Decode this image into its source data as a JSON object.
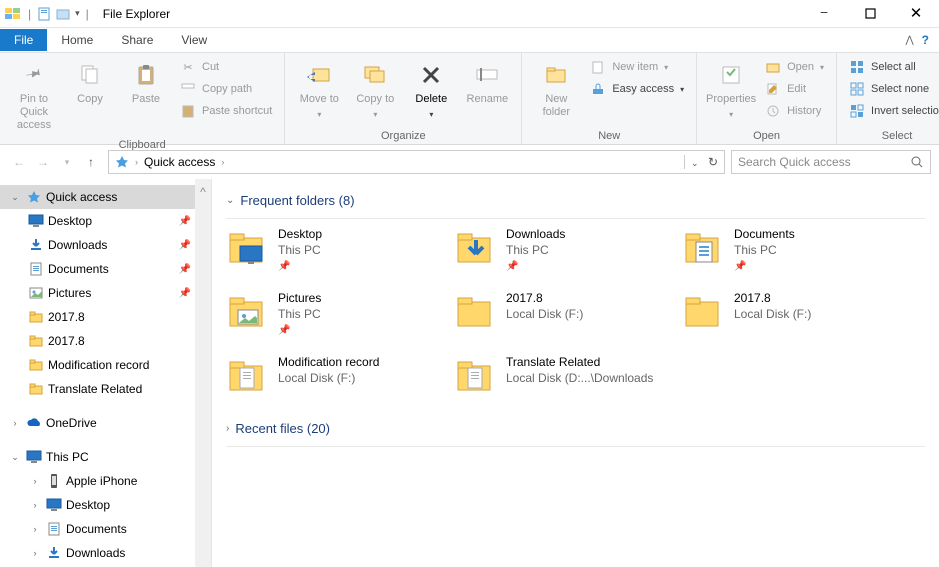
{
  "title": "File Explorer",
  "tabs": {
    "file": "File",
    "home": "Home",
    "share": "Share",
    "view": "View"
  },
  "ribbon": {
    "clipboard": {
      "label": "Clipboard",
      "pin": "Pin to Quick access",
      "copy": "Copy",
      "paste": "Paste",
      "cut": "Cut",
      "copypath": "Copy path",
      "pasteshort": "Paste shortcut"
    },
    "organize": {
      "label": "Organize",
      "moveto": "Move to",
      "copyto": "Copy to",
      "delete": "Delete",
      "rename": "Rename"
    },
    "new": {
      "label": "New",
      "newfolder": "New folder",
      "newitem": "New item",
      "easyaccess": "Easy access"
    },
    "open": {
      "label": "Open",
      "properties": "Properties",
      "open": "Open",
      "edit": "Edit",
      "history": "History"
    },
    "select": {
      "label": "Select",
      "all": "Select all",
      "none": "Select none",
      "invert": "Invert selection"
    }
  },
  "breadcrumb": {
    "root": "Quick access"
  },
  "search": {
    "placeholder": "Search Quick access"
  },
  "sidebar": {
    "quickaccess": "Quick access",
    "items": [
      {
        "label": "Desktop",
        "icon": "desktop",
        "pinned": true
      },
      {
        "label": "Downloads",
        "icon": "downloads",
        "pinned": true
      },
      {
        "label": "Documents",
        "icon": "documents",
        "pinned": true
      },
      {
        "label": "Pictures",
        "icon": "pictures",
        "pinned": true
      },
      {
        "label": "2017.8",
        "icon": "folder",
        "pinned": false
      },
      {
        "label": "2017.8",
        "icon": "folder",
        "pinned": false
      },
      {
        "label": "Modification record",
        "icon": "folder",
        "pinned": false
      },
      {
        "label": "Translate Related",
        "icon": "folder",
        "pinned": false
      }
    ],
    "onedrive": "OneDrive",
    "thispc": "This PC",
    "pcitems": [
      {
        "label": "Apple iPhone",
        "icon": "phone"
      },
      {
        "label": "Desktop",
        "icon": "desktop"
      },
      {
        "label": "Documents",
        "icon": "documents"
      },
      {
        "label": "Downloads",
        "icon": "downloads"
      }
    ]
  },
  "sections": {
    "frequent": "Frequent folders (8)",
    "recent": "Recent files (20)"
  },
  "folders": [
    {
      "name": "Desktop",
      "loc": "This PC",
      "icon": "desktop-folder",
      "pinned": true
    },
    {
      "name": "Downloads",
      "loc": "This PC",
      "icon": "downloads-folder",
      "pinned": true
    },
    {
      "name": "Documents",
      "loc": "This PC",
      "icon": "documents-folder",
      "pinned": true
    },
    {
      "name": "Pictures",
      "loc": "This PC",
      "icon": "pictures-folder",
      "pinned": true
    },
    {
      "name": "2017.8",
      "loc": "Local Disk (F:)",
      "icon": "folder",
      "pinned": false
    },
    {
      "name": "2017.8",
      "loc": "Local Disk (F:)",
      "icon": "folder",
      "pinned": false
    },
    {
      "name": "Modification record",
      "loc": "Local Disk (F:)",
      "icon": "folder-docs",
      "pinned": false
    },
    {
      "name": "Translate Related",
      "loc": "Local Disk (D:...\\Downloads",
      "icon": "folder-docs",
      "pinned": false
    }
  ]
}
